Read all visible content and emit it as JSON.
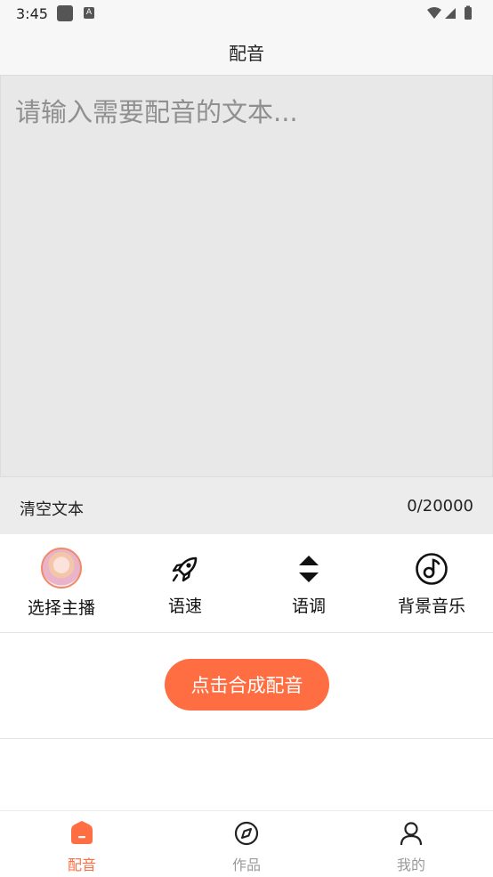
{
  "status_bar": {
    "time": "3:45",
    "notif_icon_text": "A"
  },
  "header": {
    "title": "配音"
  },
  "editor": {
    "placeholder": "请输入需要配音的文本...",
    "clear_label": "清空文本",
    "counter": "0/20000"
  },
  "options": [
    {
      "label": "选择主播",
      "icon": "anchor-avatar"
    },
    {
      "label": "语速",
      "icon": "rocket-icon"
    },
    {
      "label": "语调",
      "icon": "up-down-arrows-icon"
    },
    {
      "label": "背景音乐",
      "icon": "music-note-icon"
    }
  ],
  "synthesize": {
    "label": "点击合成配音"
  },
  "bottom_nav": [
    {
      "label": "配音",
      "icon": "home-icon",
      "active": true
    },
    {
      "label": "作品",
      "icon": "compass-icon",
      "active": false
    },
    {
      "label": "我的",
      "icon": "user-icon",
      "active": false
    }
  ],
  "colors": {
    "accent": "#ff6e42",
    "editor_bg": "#e8e8e8",
    "inactive": "#9a9a9a"
  }
}
